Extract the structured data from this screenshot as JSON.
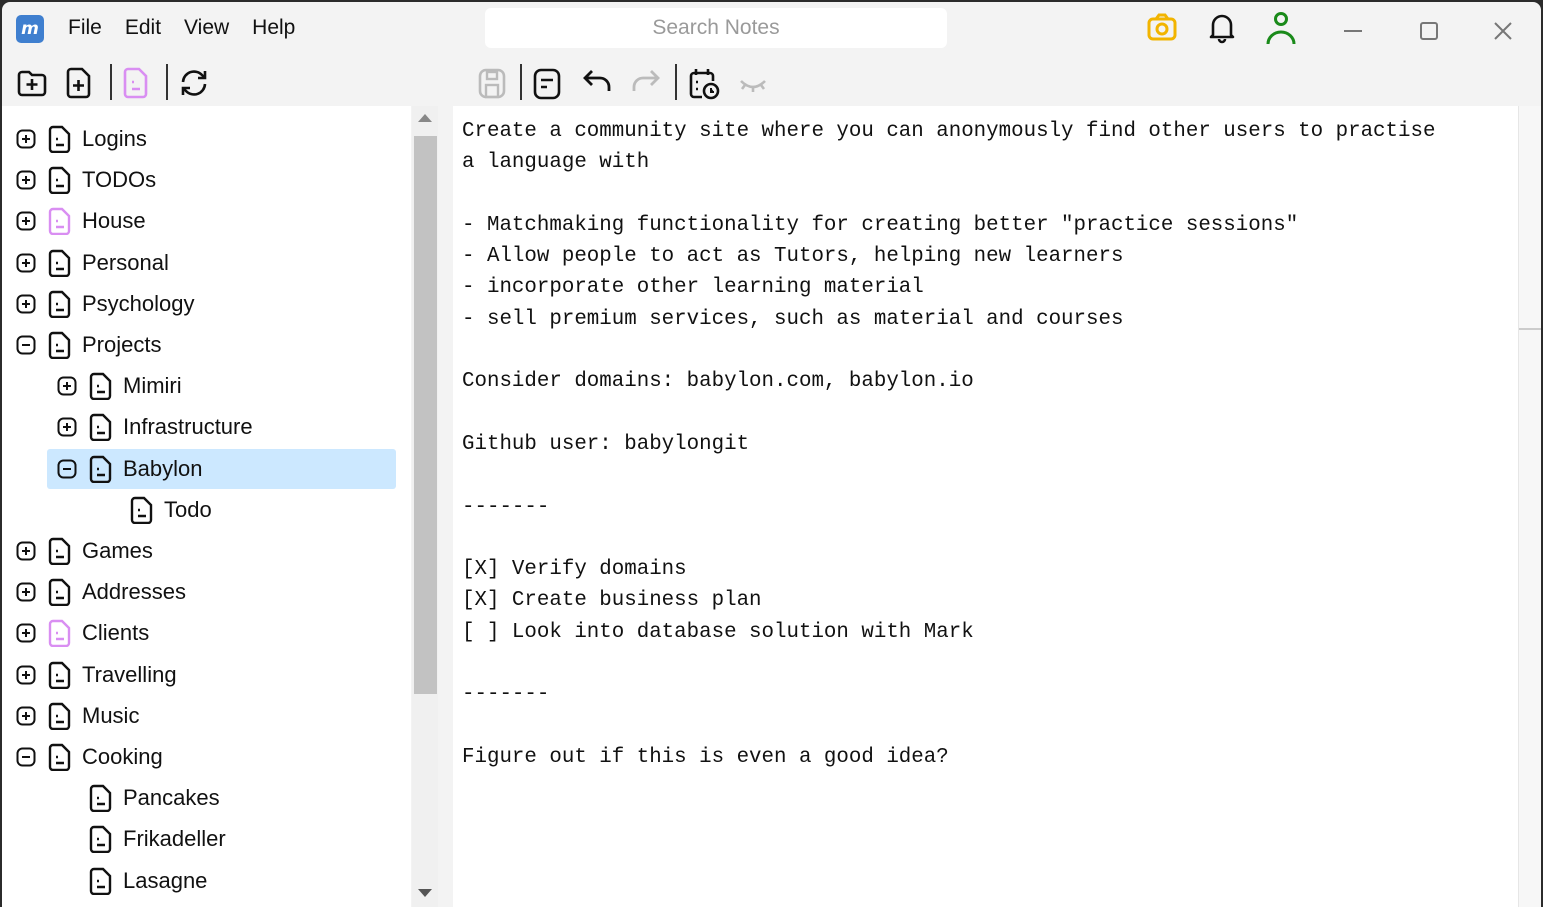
{
  "menu": {
    "items": [
      "File",
      "Edit",
      "View",
      "Help"
    ]
  },
  "search": {
    "placeholder": "Search Notes"
  },
  "colors": {
    "accent_pink": "#d98ef2",
    "camera": "#f2b400",
    "user": "#1a8a1a",
    "selection": "#cce8ff"
  },
  "tree": [
    {
      "label": "Logins",
      "level": 0,
      "expander": "plus"
    },
    {
      "label": "TODOs",
      "level": 0,
      "expander": "plus"
    },
    {
      "label": "House",
      "level": 0,
      "expander": "plus",
      "pink": true
    },
    {
      "label": "Personal",
      "level": 0,
      "expander": "plus"
    },
    {
      "label": "Psychology",
      "level": 0,
      "expander": "plus"
    },
    {
      "label": "Projects",
      "level": 0,
      "expander": "minus"
    },
    {
      "label": "Mimiri",
      "level": 1,
      "expander": "plus"
    },
    {
      "label": "Infrastructure",
      "level": 1,
      "expander": "plus"
    },
    {
      "label": "Babylon",
      "level": 1,
      "expander": "minus",
      "selected": true
    },
    {
      "label": "Todo",
      "level": 2,
      "expander": "none"
    },
    {
      "label": "Games",
      "level": 0,
      "expander": "plus"
    },
    {
      "label": "Addresses",
      "level": 0,
      "expander": "plus"
    },
    {
      "label": "Clients",
      "level": 0,
      "expander": "plus",
      "pink": true
    },
    {
      "label": "Travelling",
      "level": 0,
      "expander": "plus"
    },
    {
      "label": "Music",
      "level": 0,
      "expander": "plus"
    },
    {
      "label": "Cooking",
      "level": 0,
      "expander": "minus"
    },
    {
      "label": "Pancakes",
      "level": 1,
      "expander": "none"
    },
    {
      "label": "Frikadeller",
      "level": 1,
      "expander": "none"
    },
    {
      "label": "Lasagne",
      "level": 1,
      "expander": "none"
    }
  ],
  "editor": {
    "content": "Create a community site where you can anonymously find other users to practise\na language with\n\n- Matchmaking functionality for creating better \"practice sessions\"\n- Allow people to act as Tutors, helping new learners\n- incorporate other learning material\n- sell premium services, such as material and courses\n\nConsider domains: babylon.com, babylon.io\n\nGithub user: babylongit\n\n-------\n\n[X] Verify domains\n[X] Create business plan\n[ ] Look into database solution with Mark\n\n-------\n\nFigure out if this is even a good idea?"
  }
}
